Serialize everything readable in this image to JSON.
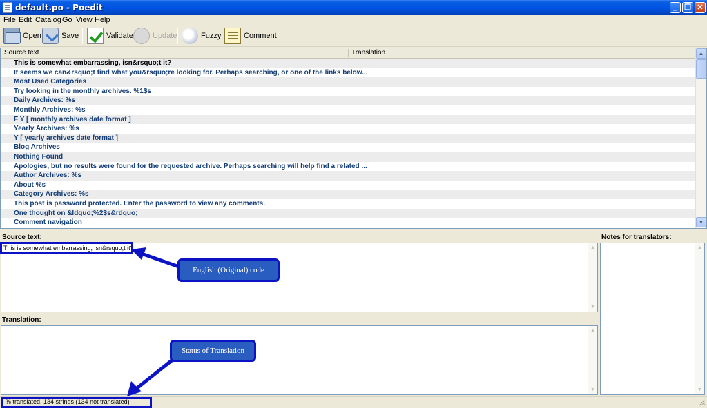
{
  "window": {
    "title": "default.po - Poedit",
    "buttons": {
      "minimize": "_",
      "restore": "❐",
      "close": "✕"
    }
  },
  "menu": [
    "File",
    "Edit",
    "Catalog",
    "Go",
    "View",
    "Help"
  ],
  "toolbar": {
    "open_label": "Open",
    "save_label": "Save",
    "validate_label": "Validate",
    "update_label": "Update",
    "fuzzy_label": "Fuzzy",
    "comment_label": "Comment"
  },
  "list": {
    "col_source": "Source text",
    "col_translation": "Translation",
    "rows": [
      "This is somewhat embarrassing, isn&rsquo;t it?",
      "It seems we can&rsquo;t find what you&rsquo;re looking for. Perhaps searching, or one of the links below...",
      "Most Used Categories",
      "Try looking in the monthly archives. %1$s",
      "Daily Archives: %s",
      "Monthly Archives: %s",
      "F Y  [ monthly archives date format ]",
      "Yearly Archives: %s",
      "Y  [ yearly archives date format ]",
      "Blog Archives",
      "Nothing Found",
      "Apologies, but no results were found for the requested archive. Perhaps searching will help find a related ...",
      "Author Archives: %s",
      "About %s",
      "Category Archives: %s",
      "This post is password protected. Enter the password to view any comments.",
      "One thought on &ldquo;%2$s&rdquo;",
      "Comment navigation"
    ]
  },
  "panels": {
    "source_label": "Source text:",
    "source_value": "This is somewhat embarrassing, isn&rsquo;t it?",
    "translation_label": "Translation:",
    "notes_label": "Notes for translators:"
  },
  "annotations": {
    "source_callout": "English (Original) code",
    "status_callout": "Status of Translation"
  },
  "status": {
    "text": "% translated, 134 strings (134 not translated)"
  },
  "colors": {
    "annotation_border": "#0b13c4",
    "annotation_fill": "#2a5dc0",
    "row_text": "#153e75"
  }
}
